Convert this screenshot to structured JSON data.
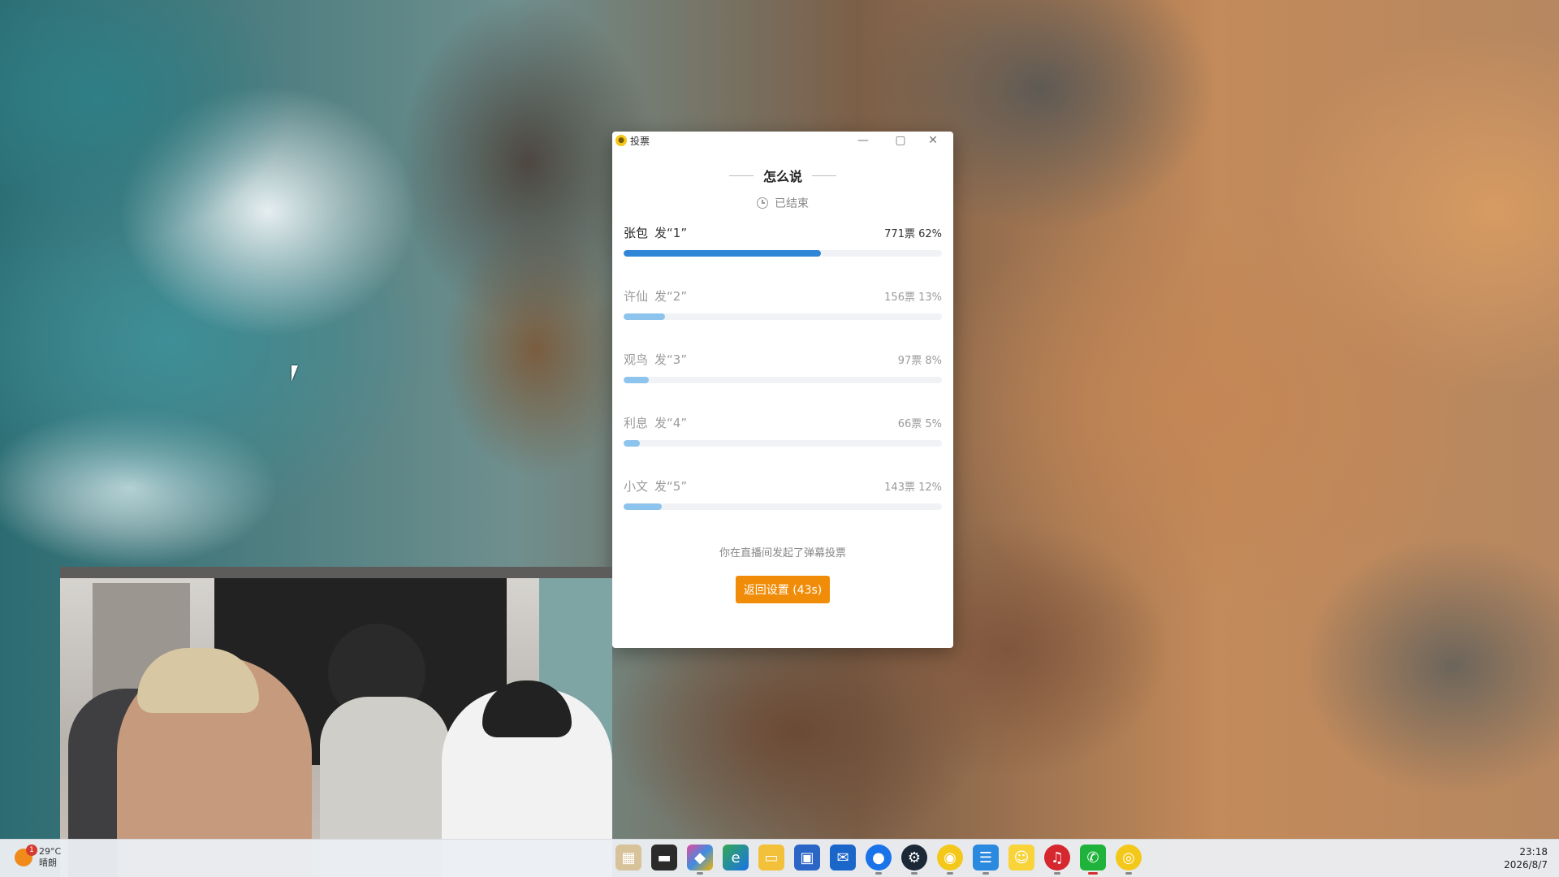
{
  "window": {
    "title": "投票",
    "min_glyph": "—",
    "max_glyph": "▢",
    "close_glyph": "✕"
  },
  "poll": {
    "title": "怎么说",
    "status": "已结束",
    "options": [
      {
        "name": "张包",
        "command": "发“1”",
        "stat": "771票 62%",
        "percent": 62
      },
      {
        "name": "许仙",
        "command": "发“2”",
        "stat": "156票 13%",
        "percent": 13
      },
      {
        "name": "观鸟",
        "command": "发“3”",
        "stat": "97票 8%",
        "percent": 8
      },
      {
        "name": "利息",
        "command": "发“4”",
        "stat": "66票 5%",
        "percent": 5
      },
      {
        "name": "小文",
        "command": "发“5”",
        "stat": "143票 12%",
        "percent": 12
      }
    ],
    "footer_note": "你在直播间发起了弹幕投票",
    "back_button": "返回设置 (43s)"
  },
  "taskbar": {
    "weather_badge": "1",
    "weather_temp": "29°C",
    "weather_desc": "晴朗",
    "time": "23:18",
    "date": "2026/8/7",
    "icons": [
      "task-view-icon",
      "terminal-icon",
      "colorful-app-icon",
      "edge-browser-icon",
      "file-explorer-icon",
      "microsoft-store-icon",
      "outlook-icon",
      "chrome-icon",
      "steam-icon",
      "yellow-app-icon",
      "notepad-icon",
      "bilibili-icon",
      "netease-music-icon",
      "wechat-icon",
      "live-app-icon"
    ],
    "colors": {
      "accent": "#f18c08",
      "bar_primary": "#2f86d6",
      "bar_secondary": "#8cc4ee"
    }
  }
}
